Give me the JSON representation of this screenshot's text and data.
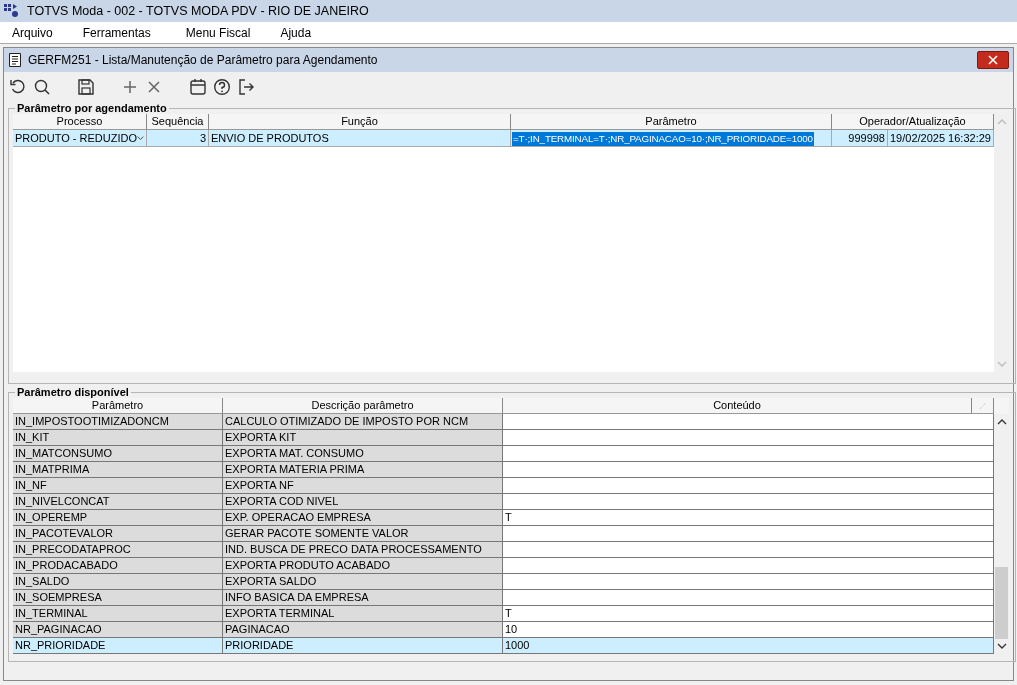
{
  "app_window": {
    "title": "TOTVS Moda - 002 - TOTVS MODA PDV - RIO DE JANEIRO"
  },
  "menu": [
    "Arquivo",
    "Ferramentas",
    "Menu Fiscal",
    "Ajuda"
  ],
  "inner_window": {
    "title": "GERFM251 - Lista/Manutenção de Parâmetro para Agendamento"
  },
  "schedule_group": {
    "title": "Parâmetro por agendamento",
    "columns": [
      "Processo",
      "Sequência",
      "Função",
      "Parâmetro",
      "Operador/Atualização"
    ],
    "rows": [
      {
        "processo": "PRODUTO - REDUZIDO",
        "sequencia": "3",
        "funcao": "ENVIO DE PRODUTOS",
        "parametro": "=T·;IN_TERMINAL=T·;NR_PAGINACAO=10·;NR_PRIORIDADE=1000",
        "parametro_highlighted": true,
        "operador": "999998",
        "atualizacao": "19/02/2025 16:32:29",
        "selected": true
      }
    ]
  },
  "available_group": {
    "title": "Parâmetro disponível",
    "columns": [
      "Parâmetro",
      "Descrição parâmetro",
      "Conteúdo"
    ],
    "rows": [
      {
        "parametro": "IN_IMPOSTOOTIMIZADONCM",
        "descricao": "CALCULO OTIMIZADO DE IMPOSTO POR NCM",
        "conteudo": "",
        "selected": false
      },
      {
        "parametro": "IN_KIT",
        "descricao": "EXPORTA KIT",
        "conteudo": "",
        "selected": false
      },
      {
        "parametro": "IN_MATCONSUMO",
        "descricao": "EXPORTA MAT. CONSUMO",
        "conteudo": "",
        "selected": false
      },
      {
        "parametro": "IN_MATPRIMA",
        "descricao": "EXPORTA MATERIA PRIMA",
        "conteudo": "",
        "selected": false
      },
      {
        "parametro": "IN_NF",
        "descricao": "EXPORTA NF",
        "conteudo": "",
        "selected": false
      },
      {
        "parametro": "IN_NIVELCONCAT",
        "descricao": "EXPORTA COD NIVEL",
        "conteudo": "",
        "selected": false
      },
      {
        "parametro": "IN_OPEREMP",
        "descricao": "EXP. OPERACAO EMPRESA",
        "conteudo": "T",
        "selected": false
      },
      {
        "parametro": "IN_PACOTEVALOR",
        "descricao": "GERAR PACOTE SOMENTE VALOR",
        "conteudo": "",
        "selected": false
      },
      {
        "parametro": "IN_PRECODATAPROC",
        "descricao": "IND. BUSCA DE PRECO DATA PROCESSAMENTO",
        "conteudo": "",
        "selected": false
      },
      {
        "parametro": "IN_PRODACABADO",
        "descricao": "EXPORTA PRODUTO ACABADO",
        "conteudo": "",
        "selected": false
      },
      {
        "parametro": "IN_SALDO",
        "descricao": "EXPORTA SALDO",
        "conteudo": "",
        "selected": false
      },
      {
        "parametro": "IN_SOEMPRESA",
        "descricao": "INFO BASICA DA EMPRESA",
        "conteudo": "",
        "selected": false
      },
      {
        "parametro": "IN_TERMINAL",
        "descricao": "EXPORTA TERMINAL",
        "conteudo": "T",
        "selected": false
      },
      {
        "parametro": "NR_PAGINACAO",
        "descricao": "PAGINACAO",
        "conteudo": "10",
        "selected": false
      },
      {
        "parametro": "NR_PRIORIDADE",
        "descricao": "PRIORIDADE",
        "conteudo": "1000",
        "selected": true
      }
    ]
  }
}
